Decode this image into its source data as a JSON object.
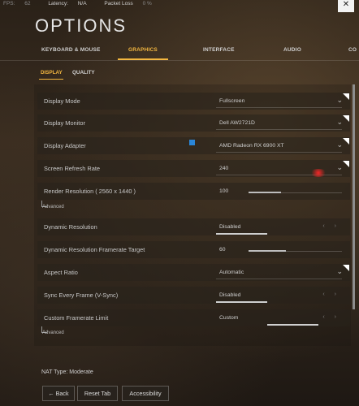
{
  "stats": {
    "fps_label": "FPS:",
    "fps_value": "62",
    "latency_label": "Latency:",
    "latency_value": "N/A",
    "packet_label": "Packet Loss",
    "packet_value": "0 %"
  },
  "close_label": "✕",
  "title": "OPTIONS",
  "main_tabs": [
    "KEYBOARD & MOUSE",
    "GRAPHICS",
    "INTERFACE",
    "AUDIO",
    "CO"
  ],
  "sub_tabs": [
    "DISPLAY",
    "QUALITY"
  ],
  "rows": [
    {
      "label": "Display Mode",
      "value": "Fullscreen"
    },
    {
      "label": "Display Monitor",
      "value": "Dell AW2721D"
    },
    {
      "label": "Display Adapter",
      "value": "AMD Radeon RX 6900 XT"
    },
    {
      "label": "Screen Refresh Rate",
      "value": "240"
    },
    {
      "label": "Render Resolution ( 2560 x 1440 )",
      "value": "100",
      "slider": 0.35
    },
    {
      "label": "Dynamic Resolution",
      "value": "Disabled"
    },
    {
      "label": "Dynamic Resolution Framerate Target",
      "value": "60",
      "slider": 0.4
    },
    {
      "label": "Aspect Ratio",
      "value": "Automatic"
    },
    {
      "label": "Sync Every Frame (V-Sync)",
      "value": "Disabled"
    },
    {
      "label": "Custom Framerate Limit",
      "value": "Custom"
    }
  ],
  "advanced_label": "Advanced",
  "nat_type": "NAT Type: Moderate",
  "buttons": {
    "back": "Back",
    "reset": "Reset Tab",
    "accessibility": "Accessibility"
  },
  "colors": {
    "accent": "#f3b740"
  }
}
